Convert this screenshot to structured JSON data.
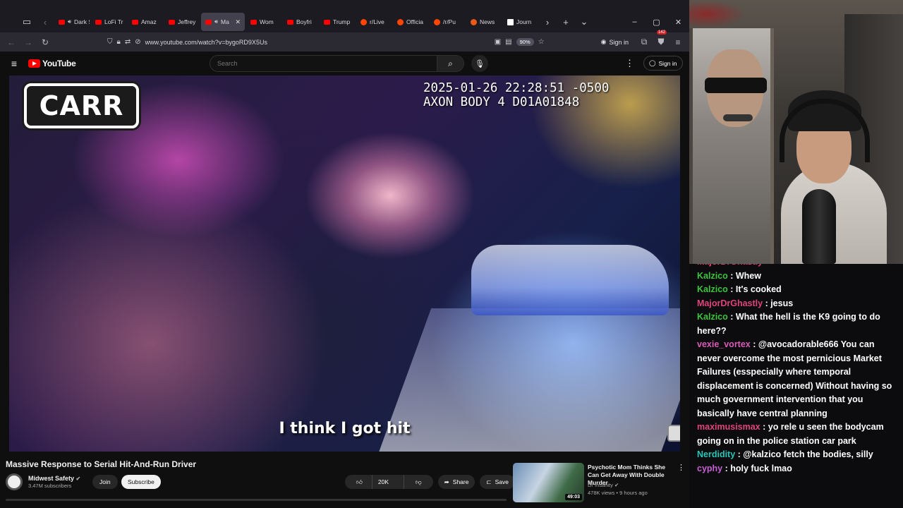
{
  "browser": {
    "tabs": [
      {
        "label": "Dark S",
        "favicon": "youtube-icon",
        "audio": true,
        "active": false
      },
      {
        "label": "LoFi Tr",
        "favicon": "youtube-icon",
        "audio": false,
        "active": false
      },
      {
        "label": "Amaz",
        "favicon": "youtube-icon",
        "audio": false,
        "active": false
      },
      {
        "label": "Jeffrey",
        "favicon": "youtube-icon",
        "audio": false,
        "active": false
      },
      {
        "label": "Ma",
        "favicon": "youtube-icon",
        "audio": true,
        "active": true
      },
      {
        "label": "Wom",
        "favicon": "youtube-icon",
        "audio": false,
        "active": false
      },
      {
        "label": "Boyfri",
        "favicon": "youtube-icon",
        "audio": false,
        "active": false
      },
      {
        "label": "Trump",
        "favicon": "youtube-icon",
        "audio": false,
        "active": false
      },
      {
        "label": "r/Live",
        "favicon": "reddit-icon",
        "audio": false,
        "active": false
      },
      {
        "label": "Officia",
        "favicon": "reddit-icon",
        "audio": false,
        "active": false
      },
      {
        "label": "/r/Pu",
        "favicon": "reddit-icon",
        "audio": false,
        "active": false
      },
      {
        "label": "News",
        "favicon": "news-icon",
        "audio": false,
        "active": false
      },
      {
        "label": "Journ",
        "favicon": "journal-icon",
        "audio": false,
        "active": false
      }
    ],
    "url": "www.youtube.com/watch?v=bygoRD9X5Us",
    "zoom": "90%",
    "signin_label": "Sign in",
    "extension_badge": "142"
  },
  "youtube": {
    "logo_text": "YouTube",
    "search_placeholder": "Search",
    "signin_label": "Sign in",
    "video": {
      "overlay_badge": "CARR",
      "timestamp_line1": "2025-01-26 22:28:51 -0500",
      "timestamp_line2": "AXON BODY 4 D01A01848",
      "subtitle": "I think I got hit"
    },
    "title": "Massive Response to Serial Hit-And-Run Driver",
    "channel": {
      "name": "Midwest Safety",
      "subscribers": "3.47M subscribers",
      "join_label": "Join",
      "subscribe_label": "Subscribe"
    },
    "actions": {
      "likes": "20K",
      "share_label": "Share",
      "save_label": "Save"
    },
    "recommended": {
      "title": "Psychotic Mom Thinks She Can Get Away With Double Murder",
      "channel": "Dr Insanity",
      "stats": "478K views • 9 hours ago",
      "duration": "49:03"
    }
  },
  "chat": {
    "messages": [
      {
        "user": "MajorDrGhastly",
        "color": "#e0447a",
        "text": ""
      },
      {
        "user": "Kalzico",
        "color": "#3cc43c",
        "text": "Whew"
      },
      {
        "user": "Kalzico",
        "color": "#3cc43c",
        "text": "It's cooked"
      },
      {
        "user": "MajorDrGhastly",
        "color": "#e0447a",
        "text": "jesus"
      },
      {
        "user": "Kalzico",
        "color": "#3cc43c",
        "text": "What the hell is the K9 going to do here??"
      },
      {
        "user": "vexie_vortex",
        "color": "#d95ab8",
        "text": "@avocadorable666 You can never overcome the most pernicious Market Failures (esspecially where temporal displacement is concerned) Without having so much government intervention that you basically have central planning"
      },
      {
        "user": "maximusismax",
        "color": "#e0447a",
        "text": "yo rele u seen the bodycam going on in the police station car park"
      },
      {
        "user": "Nerdidity",
        "color": "#27c6b8",
        "text": "@kalzico fetch the bodies, silly"
      },
      {
        "user": "cyphy",
        "color": "#c85fd6",
        "text": "holy fuck lmao"
      }
    ]
  }
}
